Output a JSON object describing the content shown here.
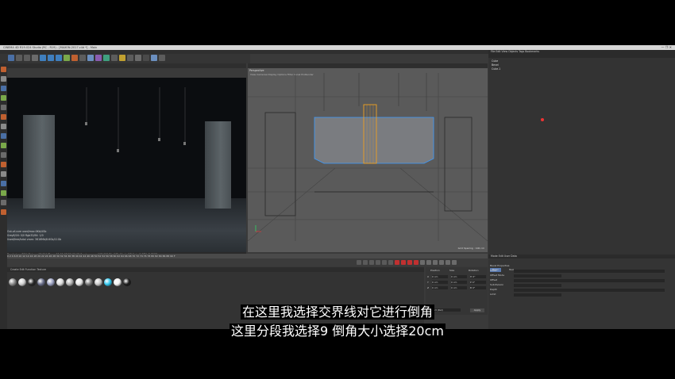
{
  "window": {
    "title": "CINEMA 4D R19.024 Studio (RC - R19) - [MAXON-2017.c4d *] - Main",
    "controls": "—  ❐  ✕"
  },
  "menus": [
    "File",
    "Edit",
    "Create",
    "Select",
    "Tools",
    "Mesh",
    "Snap",
    "Animate",
    "Simulate",
    "Tracker",
    "MoGraph",
    "Character",
    "Pipeline",
    "Plugins",
    "Octane",
    "Script",
    "Window",
    "Help"
  ],
  "left_viewport": {
    "header": "Live Viewer  [RUNNING] 2 GPU(s) 1920x1080",
    "stats": [
      "Out-of-core used/max:0Kb/4Gb",
      "Grey8/16: 0/0   Rgb32/64: 1/0",
      "Used/free/total vram: 3616Mb/8.6Gb/11Gb"
    ],
    "status": "Rendering: 39%   Ms/sec: 13.514   Time: 00:00:05/00:00:15   Spp/maxspp: 112/400   Tri: 0/3k   Mesh: 28   Hair: 0   GPU: 2   71°C"
  },
  "right_viewport": {
    "header": "View  Cameras  Display  Options  Filter  Panel  ProRender",
    "label": "Perspective",
    "footer": "Grid Spacing : 100 cm"
  },
  "timeline": {
    "ruler": "0  2  4  6  8  10  12  14  16  18  20  22  24  26  28  30  32  34  36  38  40  42  44  46  48  50  52  54  56  58  60  62  64  66  68  70  72  74  76  78  80  82  84  86  88  90 F",
    "start": "0 F",
    "end": "90 F"
  },
  "materials": {
    "header": "Create  Edit  Function  Texture",
    "balls": [
      "#8a8a8a",
      "#cfcfcf",
      "#2a2a2a",
      "#6a6f8a",
      "#9aa0c0",
      "#d9d9d9",
      "#b0b0b0",
      "#e4e4e4",
      "#7a7a7a",
      "#c8c8c8",
      "#32c8f0",
      "#f2f2f2",
      "#1e1e1e"
    ]
  },
  "coordinates": {
    "headers": [
      "Position",
      "Size",
      "Rotation"
    ],
    "rows": [
      {
        "axis": "X",
        "pos": "0 cm",
        "size": "0 cm",
        "rot": "H 0°"
      },
      {
        "axis": "Y",
        "pos": "0 cm",
        "size": "0 cm",
        "rot": "P 0°"
      },
      {
        "axis": "Z",
        "pos": "0 cm",
        "size": "0 cm",
        "rot": "B 0°"
      }
    ],
    "mode": "Object (Rel)",
    "apply": "Apply"
  },
  "objects": {
    "tabs": "File  Edit  View  Objects  Tags  Bookmarks",
    "rows": [
      "Cube",
      "Bevel",
      "Cube.1"
    ]
  },
  "attributes": {
    "header": "Mode  Edit  User Data",
    "tabs": [
      "Basic",
      "Tool"
    ],
    "rows": [
      "Bevel Properties",
      "Mode",
      "Offset Mode",
      "Offset",
      "Subdivision",
      "Depth",
      "Limit"
    ]
  },
  "subtitles": [
    "在这里我选择交界线对它进行倒角",
    "这里分段我选择9 倒角大小选择20cm"
  ]
}
